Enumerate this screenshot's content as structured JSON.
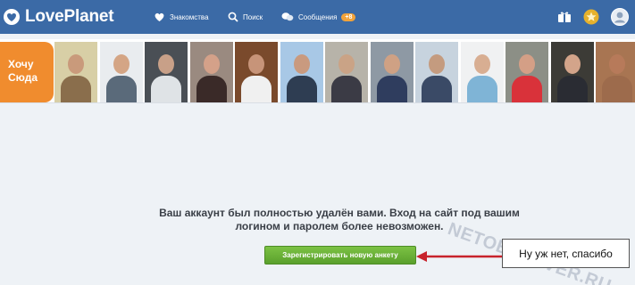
{
  "header": {
    "brand": "LovePlanet",
    "nav": {
      "dating": "Знакомства",
      "search": "Поиск",
      "messages": "Сообщения",
      "messages_badge": "+8"
    },
    "icons": [
      "heart-icon",
      "gift-icon",
      "star-icon",
      "avatar-icon"
    ]
  },
  "strip": {
    "want_here": "Хочу Сюда",
    "photos": [
      {
        "bg": "#d8cfa6",
        "skin": "#c99a7b",
        "shirt": "#8a6e4c"
      },
      {
        "bg": "#e9ecef",
        "skin": "#d4a585",
        "shirt": "#5a6a7a"
      },
      {
        "bg": "#4a4f55",
        "skin": "#c8a088",
        "shirt": "#dfe3e6"
      },
      {
        "bg": "#9a8a80",
        "skin": "#d4a189",
        "shirt": "#3a2a28"
      },
      {
        "bg": "#7a4a2c",
        "skin": "#c79479",
        "shirt": "#f0f0f0"
      },
      {
        "bg": "#a8c8e6",
        "skin": "#c99a7f",
        "shirt": "#2e3d52"
      },
      {
        "bg": "#b7b3a9",
        "skin": "#caa386",
        "shirt": "#3b3b45"
      },
      {
        "bg": "#8e99a4",
        "skin": "#cfa184",
        "shirt": "#2f3d5e"
      },
      {
        "bg": "#c7d3de",
        "skin": "#c49b7f",
        "shirt": "#3a4a66"
      },
      {
        "bg": "#f0f1f2",
        "skin": "#d8ae92",
        "shirt": "#7fb4d6"
      },
      {
        "bg": "#8c8f86",
        "skin": "#d49f86",
        "shirt": "#d9323a"
      },
      {
        "bg": "#3c3b36",
        "skin": "#d3a48a",
        "shirt": "#2a2c33"
      },
      {
        "bg": "#a87552",
        "skin": "#b77a5a",
        "shirt": "#9d6b4c"
      }
    ]
  },
  "main": {
    "message_line1": "Ваш аккаунт был полностью удалён вами. Вход на сайт под вашим",
    "message_line2": "логином и паролем более невозможен.",
    "register_button": "Зарегистрировать новую анкету",
    "callout_text": "Ну уж нет, спасибо",
    "watermark": "NETOBSERVER.RU"
  },
  "colors": {
    "header": "#3b6aa6",
    "accent_orange": "#f08c2e",
    "button_green": "#6cb33a",
    "arrow_red": "#c8232c"
  }
}
